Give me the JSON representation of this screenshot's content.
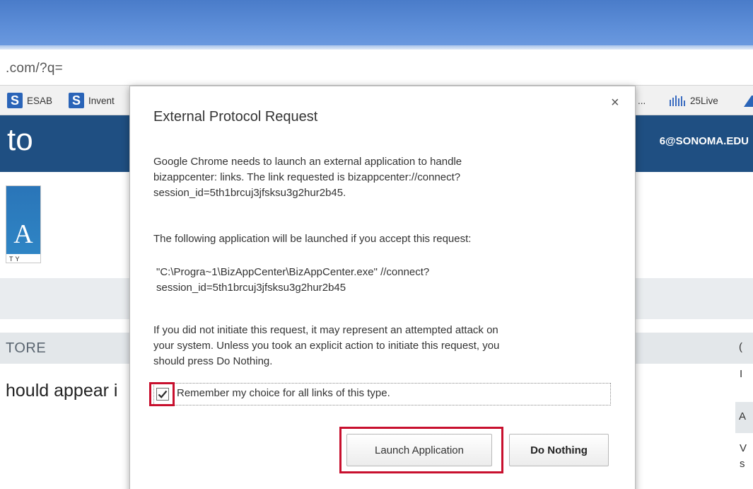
{
  "browser": {
    "url": ".com/?q=",
    "bookmarks": [
      {
        "label": "ESAB",
        "icon": "s-icon"
      },
      {
        "label": "Invent",
        "icon": "s-icon"
      },
      {
        "label": "...",
        "icon": ""
      },
      {
        "label": "25Live",
        "icon": "25live-icon"
      }
    ]
  },
  "site": {
    "brand": "to",
    "email": "6@SONOMA.EDU",
    "logo_letter": "A",
    "logo_sub": "TY",
    "store_label": "TORE",
    "body_text": "hould appear i",
    "right_letters": [
      "(",
      "I",
      "A",
      "V",
      "s"
    ]
  },
  "dialog": {
    "title": "External Protocol Request",
    "close_glyph": "×",
    "para1_line1": "Google Chrome needs to launch an external application to handle",
    "para1_line2": "bizappcenter: links. The link requested is bizappcenter://connect?",
    "para1_line3": "session_id=5th1brcuj3jfsksu3g2hur2b45.",
    "para2": "The following application will be launched if you accept this request:",
    "para3_line1": "\"C:\\Progra~1\\BizAppCenter\\BizAppCenter.exe\" //connect?",
    "para3_line2": "session_id=5th1brcuj3jfsksu3g2hur2b45",
    "para4_line1": "If you did not initiate this request, it may represent an attempted attack on",
    "para4_line2": "your system. Unless you took an explicit action to initiate this request, you",
    "para4_line3": "should press Do Nothing.",
    "remember_label": "Remember my choice for all links of this type.",
    "remember_checked": true,
    "launch_button": "Launch Application",
    "nothing_button": "Do Nothing"
  },
  "colors": {
    "highlight": "#c8102e",
    "site_header": "#1f4f82",
    "title_bar": "#5d8ed8"
  }
}
